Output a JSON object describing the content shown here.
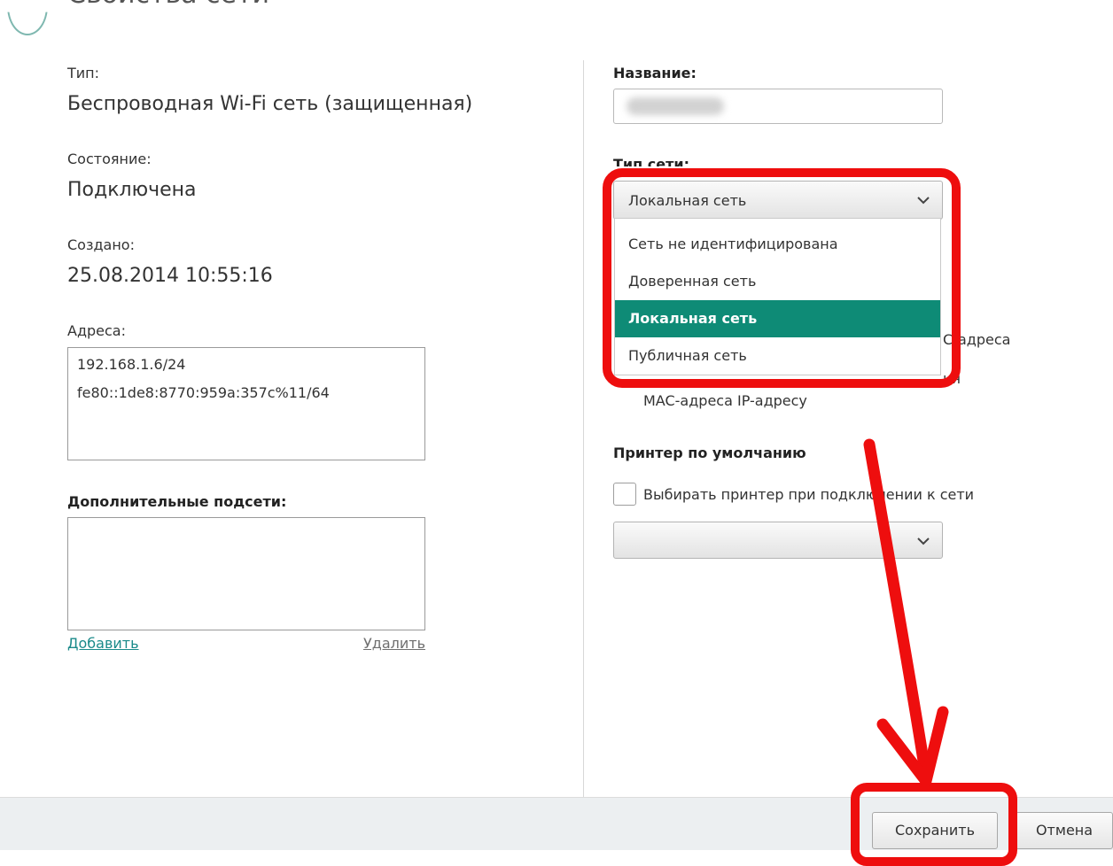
{
  "header": {
    "title": "Свойства сети"
  },
  "left": {
    "type_label": "Тип:",
    "type_value": "Беспроводная Wi-Fi сеть (защищенная)",
    "state_label": "Состояние:",
    "state_value": "Подключена",
    "created_label": "Создано:",
    "created_value": "25.08.2014 10:55:16",
    "addresses_label": "Адреса:",
    "addresses": [
      "192.168.1.6/24",
      "fe80::1de8:8770:959a:357c%11/64"
    ],
    "subnets_label": "Дополнительные подсети:",
    "add_link": "Добавить",
    "delete_link": "Удалить"
  },
  "right": {
    "name_label": "Название:",
    "network_type_label": "Тип сети:",
    "network_type_selected": "Локальная сеть",
    "network_type_options": [
      "Сеть не идентифицирована",
      "Доверенная сеть",
      "Локальная сеть",
      "Публичная сеть"
    ],
    "hidden_fragment_1": "С-адреса",
    "hidden_fragment_2": "ия",
    "mac_line": "MAC-адреса IP-адресу",
    "printer_label": "Принтер по умолчанию",
    "printer_checkbox_label": "Выбирать принтер при подключении к сети",
    "printer_select_value": ""
  },
  "footer": {
    "save_label": "Сохранить",
    "cancel_label": "Отмена"
  },
  "colors": {
    "accent": "#0e8b76",
    "link_add": "#1a8a8a",
    "link_delete": "#6f6f6f",
    "annotation": "#ee0e0e"
  }
}
